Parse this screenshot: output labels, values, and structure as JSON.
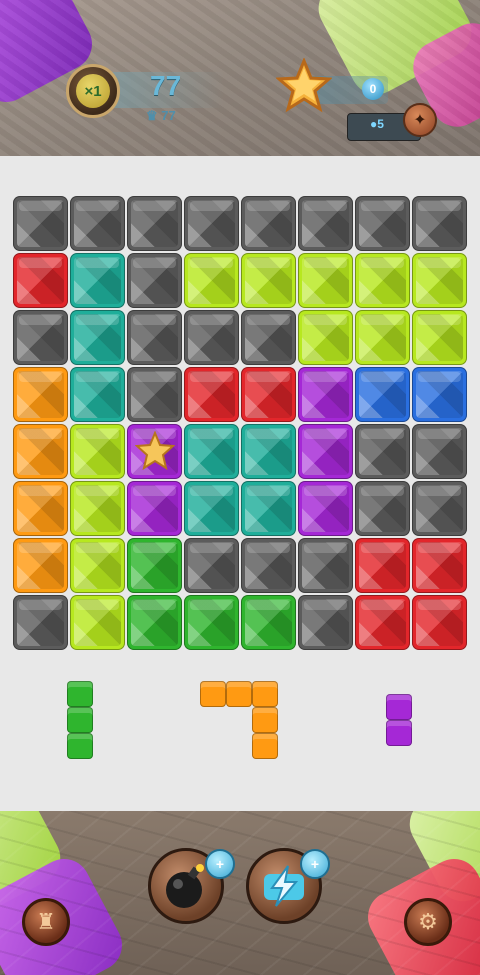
{
  "header": {
    "multiplier": "×1",
    "score": "77",
    "best_score": "77",
    "stars": "0",
    "coins": "5"
  },
  "colors": {
    "gray": "#5c5c5c",
    "red": "#e3262b",
    "teal": "#1fae9a",
    "lime": "#b7e81f",
    "orange": "#ff9a12",
    "purple": "#a528d6",
    "blue": "#2a6fe0",
    "green": "#2fb52e"
  },
  "board": [
    [
      "gray",
      "gray",
      "gray",
      "gray",
      "gray",
      "gray",
      "gray",
      "gray"
    ],
    [
      "red",
      "teal",
      "gray",
      "lime",
      "lime",
      "lime",
      "lime",
      "lime"
    ],
    [
      "gray",
      "teal",
      "gray",
      "gray",
      "gray",
      "lime",
      "lime",
      "lime"
    ],
    [
      "orange",
      "teal",
      "gray",
      "red",
      "red",
      "purple",
      "blue",
      "blue"
    ],
    [
      "orange",
      "lime",
      "purple-star",
      "teal",
      "teal",
      "purple",
      "gray",
      "gray"
    ],
    [
      "orange",
      "lime",
      "purple",
      "teal",
      "teal",
      "purple",
      "gray",
      "gray"
    ],
    [
      "orange",
      "lime",
      "green",
      "gray",
      "gray",
      "gray",
      "red",
      "red"
    ],
    [
      "gray",
      "lime",
      "green",
      "green",
      "green",
      "gray",
      "red",
      "red"
    ]
  ],
  "pieces": [
    {
      "color": "green",
      "cells": [
        [
          0,
          0
        ],
        [
          0,
          1
        ],
        [
          0,
          2
        ]
      ]
    },
    {
      "color": "orange",
      "cells": [
        [
          0,
          0
        ],
        [
          1,
          0
        ],
        [
          2,
          0
        ],
        [
          2,
          1
        ],
        [
          2,
          2
        ]
      ]
    },
    {
      "color": "purple",
      "cells": [
        [
          0,
          0
        ],
        [
          0,
          1
        ]
      ]
    }
  ],
  "powerups": [
    {
      "icon": "bomb-icon",
      "badge": "+"
    },
    {
      "icon": "lightning-icon",
      "badge": "+"
    }
  ]
}
